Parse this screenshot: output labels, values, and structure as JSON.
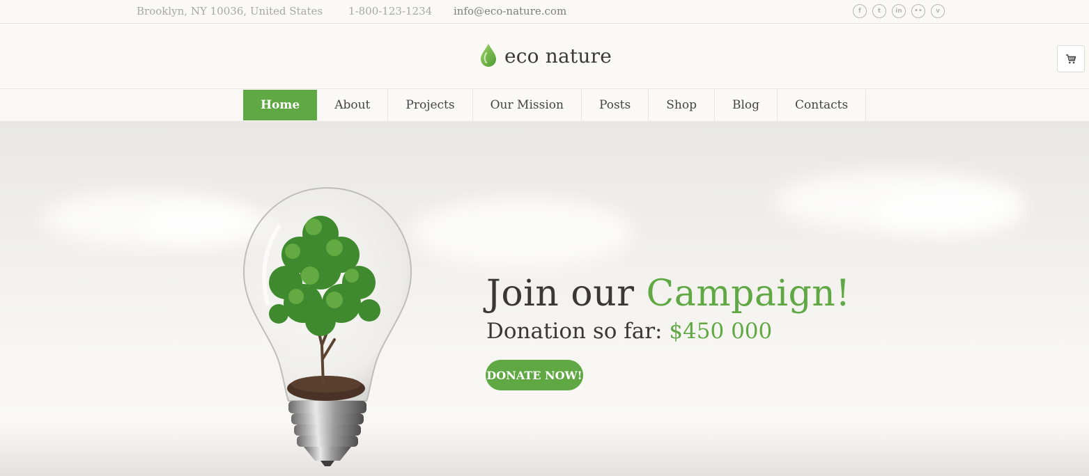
{
  "topbar": {
    "address": "Brooklyn, NY 10036, United States",
    "phone": "1-800-123-1234",
    "email": "info@eco-nature.com",
    "social": [
      {
        "icon": "facebook-icon",
        "glyph": "f"
      },
      {
        "icon": "twitter-icon",
        "glyph": "t"
      },
      {
        "icon": "linkedin-icon",
        "glyph": "in"
      },
      {
        "icon": "flickr-icon",
        "glyph": "••"
      },
      {
        "icon": "vimeo-icon",
        "glyph": "v"
      }
    ]
  },
  "header": {
    "brand": "eco nature",
    "logo_icon": "leaf-drop-icon",
    "cart_icon": "cart-icon"
  },
  "nav": {
    "items": [
      {
        "label": "Home",
        "active": true
      },
      {
        "label": "About"
      },
      {
        "label": "Projects"
      },
      {
        "label": "Our Mission"
      },
      {
        "label": "Posts"
      },
      {
        "label": "Shop"
      },
      {
        "label": "Blog"
      },
      {
        "label": "Contacts"
      }
    ]
  },
  "hero": {
    "headline_prefix": "Join our",
    "headline_accent": "Campaign!",
    "donation_label": "Donation so far:",
    "donation_amount": "$450 000",
    "cta_label": "DONATE NOW!",
    "image": "lightbulb-with-tree"
  },
  "colors": {
    "accent": "#5fa843",
    "text": "#3a3735",
    "muted": "#a7a7a7"
  }
}
